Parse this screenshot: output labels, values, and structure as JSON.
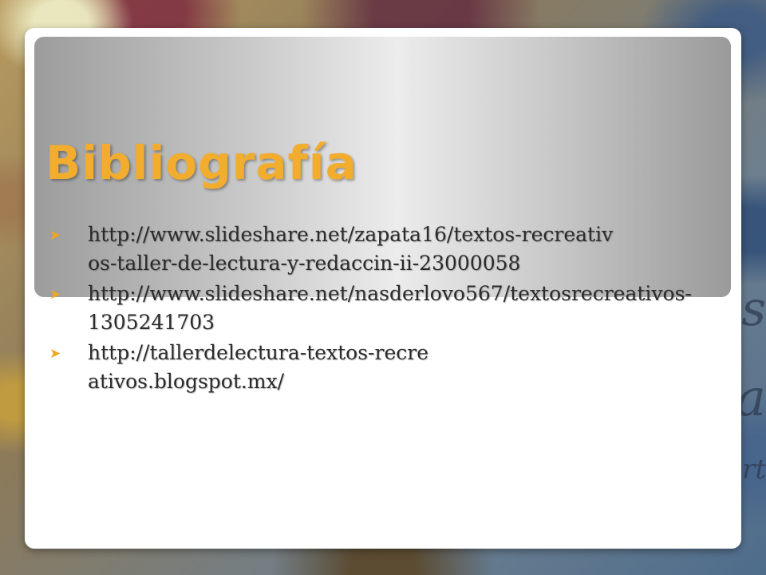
{
  "slide": {
    "title": "Bibliografía",
    "accent_color": "#f2ad2e",
    "bullet_icon": "arrow-bullet-icon",
    "references": [
      {
        "text": "http://www.slideshare.net/zapata16/textos-recreativos-taller-de-lectura-y-redaccin-ii-23000058"
      },
      {
        "text": "http://www.slideshare.net/nasderlovo567/textosrecreativos-1305241703"
      },
      {
        "text": "http://tallerdelectura-textos-recreativos.blogspot.mx/"
      }
    ]
  },
  "background_photo": {
    "visible_text_fragments": [
      "as",
      "a",
      "rt"
    ]
  }
}
